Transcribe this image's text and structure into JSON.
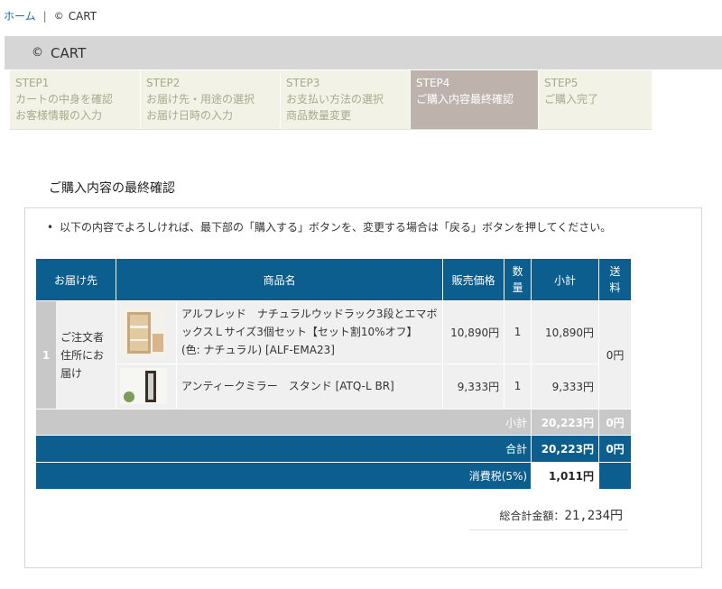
{
  "breadcrumb": {
    "home": "ホーム",
    "separator": "|",
    "current_mark": "©",
    "current": "CART"
  },
  "header": {
    "mark": "©",
    "title": "CART"
  },
  "steps": [
    {
      "step": "STEP1",
      "line1": "カートの中身を確認",
      "line2": "お客様情報の入力"
    },
    {
      "step": "STEP2",
      "line1": "お届け先・用途の選択",
      "line2": "お届け日時の入力"
    },
    {
      "step": "STEP3",
      "line1": "お支払い方法の選択",
      "line2": "商品数量変更"
    },
    {
      "step": "STEP4",
      "line1": "ご購入内容最終確認",
      "line2": ""
    },
    {
      "step": "STEP5",
      "line1": "ご購入完了",
      "line2": ""
    }
  ],
  "section_title": "ご購入内容の最終確認",
  "notice": {
    "bullet": "•",
    "text": "以下の内容でよろしければ、最下部の「購入する」ボタンを、変更する場合は「戻る」ボタンを押してください。"
  },
  "table": {
    "headers": {
      "destination": "お届け先",
      "product": "商品名",
      "price": "販売価格",
      "qty": "数量",
      "subtotal": "小計",
      "shipping": "送料"
    },
    "group": {
      "index": "1",
      "destination": "ご注文者住所にお届け",
      "shipping": "0円",
      "items": [
        {
          "name": "アルフレッド　ナチュラルウッドラック3段とエマボックスＬサイズ3個セット【セット割10%オフ】 (色: ナチュラル) [ALF-EMA23]",
          "price": "10,890円",
          "qty": "1",
          "subtotal": "10,890円",
          "image": "rack-with-boxes-image"
        },
        {
          "name": "アンティークミラー　スタンド [ATQ-L BR]",
          "price": "9,333円",
          "qty": "1",
          "subtotal": "9,333円",
          "image": "standing-mirror-image"
        }
      ]
    },
    "subtotal_row": {
      "label": "小計",
      "amount": "20,223円",
      "shipping": "0円"
    },
    "total_row": {
      "label": "合計",
      "amount": "20,223円",
      "shipping": "0円"
    },
    "tax_row": {
      "label": "消費税(5%)",
      "amount": "1,011円"
    }
  },
  "grand_total": {
    "label": "総合計金額：",
    "amount": "21,234円"
  },
  "colors": {
    "table_header": "#0c5e8e",
    "active_step": "#bdb3ac",
    "inactive_step": "#f2f2e6",
    "link": "#1a6fa8"
  }
}
